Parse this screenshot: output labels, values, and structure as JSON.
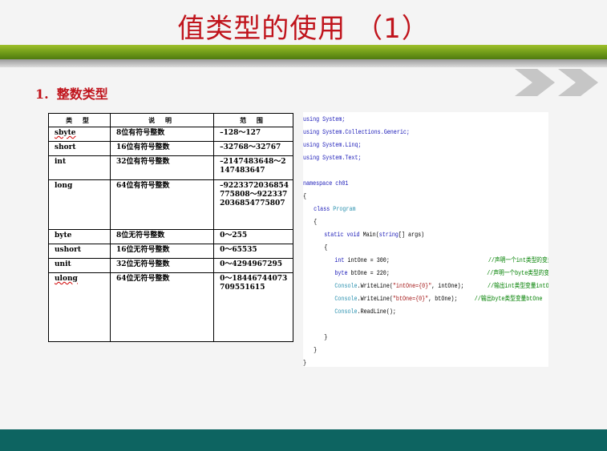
{
  "slide": {
    "title": "值类型的使用 （1）"
  },
  "section": {
    "number": "1.",
    "heading": "整数类型"
  },
  "table": {
    "headers": [
      "类 型",
      "说 明",
      "范 围"
    ],
    "rows": [
      {
        "type": "sbyte",
        "desc": "8位有符号整数",
        "range": "–128～127"
      },
      {
        "type": "short",
        "desc": "16位有符号整数",
        "range": "–32768～32767"
      },
      {
        "type": "int",
        "desc": "32位有符号整数",
        "range": "–2147483648～2147483647"
      },
      {
        "type": "long",
        "desc": "64位有符号整数",
        "range": "–9223372036854775808～9223372036854775807"
      },
      {
        "type": "byte",
        "desc": "8位无符号整数",
        "range": "0～255"
      },
      {
        "type": "ushort",
        "desc": "16位无符号整数",
        "range": "0～65535"
      },
      {
        "type": "unit",
        "desc": "32位无符号整数",
        "range": "0～4294967295"
      },
      {
        "type": "ulong",
        "desc": "64位无符号整数",
        "range": "0～18446744073709551615"
      }
    ]
  },
  "code": {
    "using1": "using System;",
    "using2": "using System.Collections.Generic;",
    "using3": "using System.Linq;",
    "using4": "using System.Text;",
    "ns_kw": "namespace",
    "ns_name": " ch01",
    "open1": "{",
    "class_kw": "class",
    "class_name": " Program",
    "open2": "{",
    "main_static": "static",
    "main_void": " void",
    "main_name": " Main(",
    "main_string": "string",
    "main_args": "[] args)",
    "open3": "{",
    "int_kw": "int",
    "int_stmt": " intOne = 300;",
    "int_comment": "//声明一个int类型的变量intOne",
    "byte_kw": "byte",
    "byte_stmt": " btOne = 220;",
    "byte_comment": "//声明一个byte类型的变量btOne",
    "wl1_console": "Console",
    "wl1_call": ".WriteLine(",
    "wl1_str": "\"intOne={0}\"",
    "wl1_args": ", intOne);",
    "wl1_comment": "//输出int类型变量intOne",
    "wl2_console": "Console",
    "wl2_call": ".WriteLine(",
    "wl2_str": "\"btOne={0}\"",
    "wl2_args": ", btOne);",
    "wl2_comment": "//输出byte类型变量btOne",
    "rl_console": "Console",
    "rl_call": ".ReadLine();",
    "close3": "}",
    "close2": "}",
    "close1": "}"
  }
}
